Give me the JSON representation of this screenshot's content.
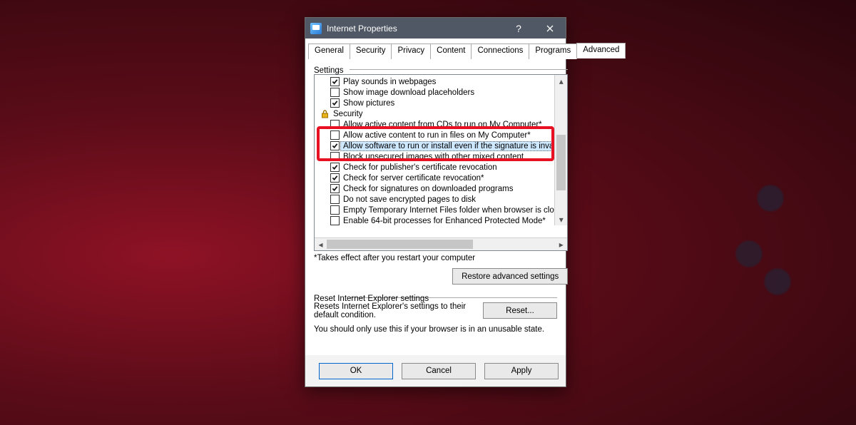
{
  "window": {
    "title": "Internet Properties"
  },
  "tabs": [
    "General",
    "Security",
    "Privacy",
    "Content",
    "Connections",
    "Programs",
    "Advanced"
  ],
  "active_tab": "Advanced",
  "settings_label": "Settings",
  "items": [
    {
      "kind": "check",
      "checked": true,
      "label": "Play sounds in webpages"
    },
    {
      "kind": "check",
      "checked": false,
      "label": "Show image download placeholders"
    },
    {
      "kind": "check",
      "checked": true,
      "label": "Show pictures"
    },
    {
      "kind": "cat",
      "label": "Security"
    },
    {
      "kind": "check",
      "checked": false,
      "label": "Allow active content from CDs to run on My Computer*"
    },
    {
      "kind": "check",
      "checked": false,
      "label": "Allow active content to run in files on My Computer*"
    },
    {
      "kind": "check",
      "checked": true,
      "label": "Allow software to run or install even if the signature is invalid",
      "selected": true
    },
    {
      "kind": "check",
      "checked": false,
      "label": "Block unsecured images with other mixed content"
    },
    {
      "kind": "check",
      "checked": true,
      "label": "Check for publisher's certificate revocation"
    },
    {
      "kind": "check",
      "checked": true,
      "label": "Check for server certificate revocation*"
    },
    {
      "kind": "check",
      "checked": true,
      "label": "Check for signatures on downloaded programs"
    },
    {
      "kind": "check",
      "checked": false,
      "label": "Do not save encrypted pages to disk"
    },
    {
      "kind": "check",
      "checked": false,
      "label": "Empty Temporary Internet Files folder when browser is closed"
    },
    {
      "kind": "check",
      "checked": false,
      "label": "Enable 64-bit processes for Enhanced Protected Mode*"
    }
  ],
  "restart_note": "*Takes effect after you restart your computer",
  "restore_btn": "Restore advanced settings",
  "reset_group_label": "Reset Internet Explorer settings",
  "reset_text": "Resets Internet Explorer's settings to their default condition.",
  "reset_btn": "Reset...",
  "reset_warn": "You should only use this if your browser is in an unusable state.",
  "footer": {
    "ok": "OK",
    "cancel": "Cancel",
    "apply": "Apply"
  }
}
